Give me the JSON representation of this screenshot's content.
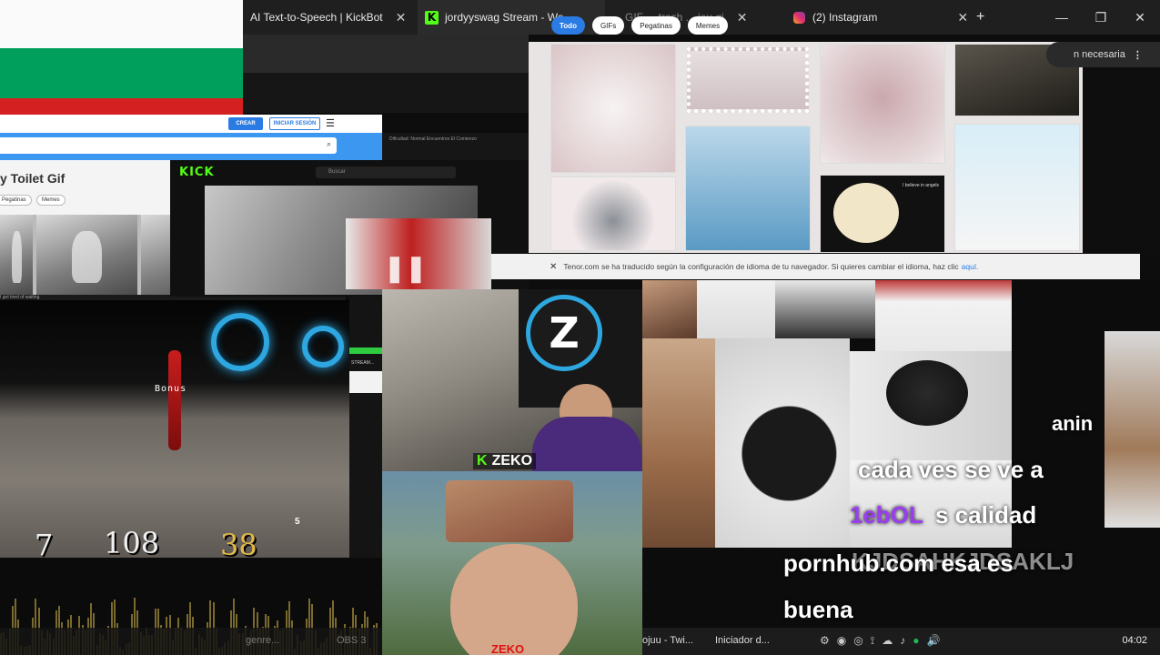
{
  "browser": {
    "tabs": [
      {
        "label": "AI Text-to-Speech | KickBot"
      },
      {
        "label": "jordyyswag Stream - We"
      },
      {
        "label": "GIF ... trash ... jou gi"
      },
      {
        "label": "(2) Instagram"
      }
    ],
    "new_tab": "+",
    "close_glyph": "✕",
    "window_controls": {
      "minimize": "—",
      "restore": "❐",
      "close": "✕"
    }
  },
  "tenor_left": {
    "crear_label": "CREAR",
    "iniciar_sesion_label": "INICIAR SESIÓN",
    "menu_glyph": "☰",
    "search_glyph": "⌕",
    "page_title": "y Toilet Gif",
    "chips": [
      "Pegatinas",
      "Memes"
    ],
    "caption": "I got tired of waiting"
  },
  "kick": {
    "logo": "KICK",
    "search_placeholder": "Buscar",
    "tabs_text": "Dificultad: Normal   Encuentros   El Comienzo"
  },
  "game_hud": {
    "bonus_text": "Bonus",
    "ammo_left": "7",
    "health": "108",
    "armor": "38",
    "keys": "5"
  },
  "chat": {
    "text": "STREAM..."
  },
  "zeko": {
    "circle_letter": "Z",
    "label_k": "K",
    "label_name": "ZEKO",
    "bottom_label": "ZEKO"
  },
  "tenor_right": {
    "chips": [
      {
        "label": "Todo",
        "active": true
      },
      {
        "label": "GIFs",
        "active": false
      },
      {
        "label": "Pegatinas",
        "active": false
      },
      {
        "label": "Memes",
        "active": false
      }
    ],
    "heart_text": "I believe in angels",
    "translation_bar": {
      "message": "Tenor.com se ha traducido según la configuración de idioma de tu navegador. Si quieres cambiar el idioma, haz clic",
      "link": "aquí."
    }
  },
  "side_button": {
    "label": "n necesaria"
  },
  "overlays": {
    "line1": "cada ves se ve a",
    "line2_purple": "1ebOL",
    "line2": "s calidad",
    "line3_ghost": "KJDSAHKJDSAKLJ",
    "line4": "pornhub.com esa es",
    "line5": "buena",
    "top_fragment": "anin"
  },
  "taskbar": {
    "left_items": [
      "genre...",
      "OBS 3"
    ],
    "right_items": [
      "ojuu - Twi...",
      "Iniciador d..."
    ],
    "clock": "04:02"
  },
  "colors": {
    "flag_white": "#fafafa",
    "flag_green": "#00a05c",
    "flag_red": "#d42020",
    "kick_green": "#53fc18",
    "tenor_blue": "#2a7be4",
    "purple_text": "#9b3df0"
  }
}
